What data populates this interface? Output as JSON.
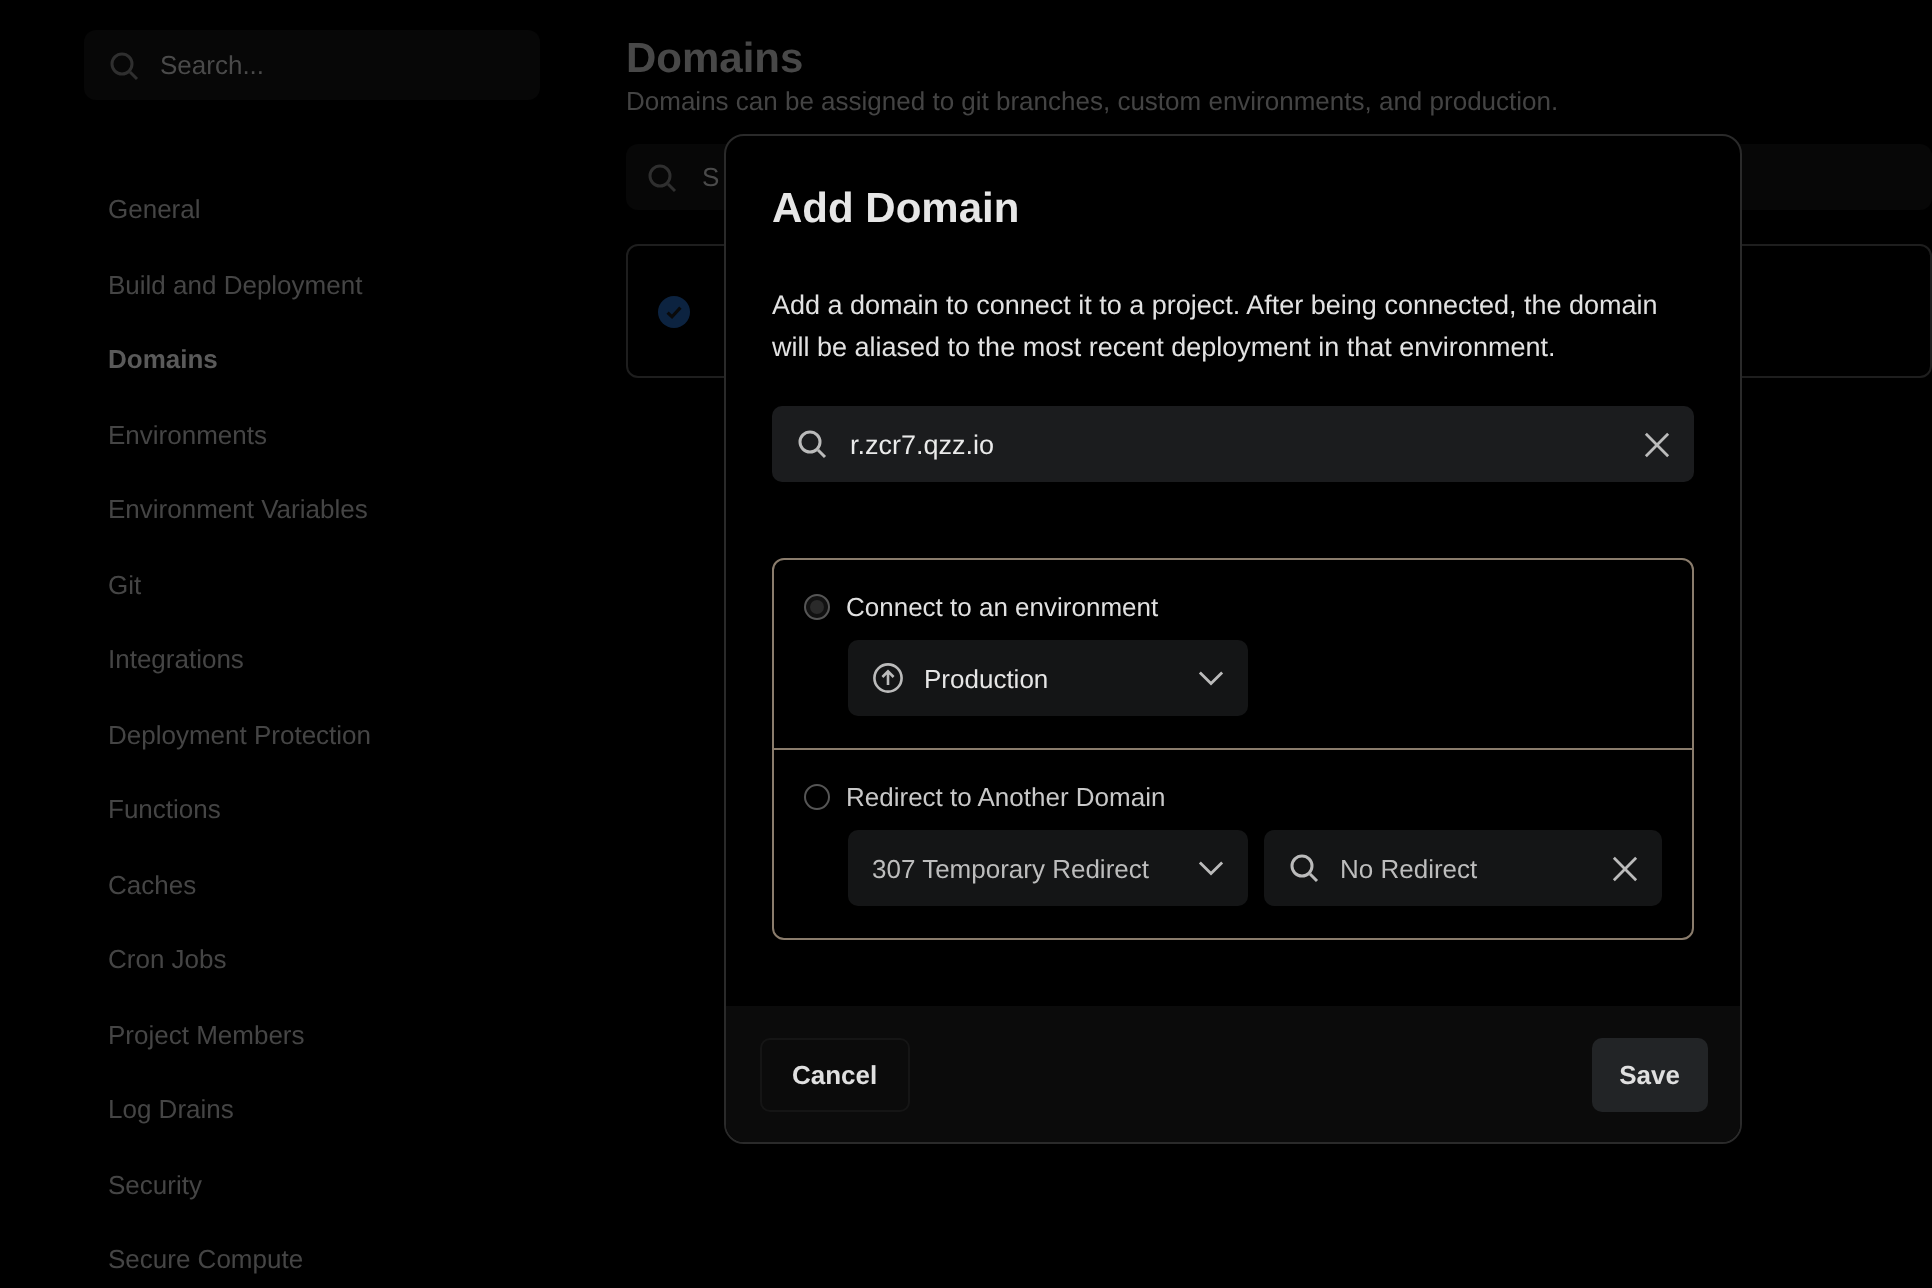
{
  "sidebar": {
    "search": {
      "placeholder": "Search..."
    },
    "items": [
      {
        "label": "General",
        "selected": false
      },
      {
        "label": "Build and Deployment",
        "selected": false
      },
      {
        "label": "Domains",
        "selected": true
      },
      {
        "label": "Environments",
        "selected": false
      },
      {
        "label": "Environment Variables",
        "selected": false
      },
      {
        "label": "Git",
        "selected": false
      },
      {
        "label": "Integrations",
        "selected": false
      },
      {
        "label": "Deployment Protection",
        "selected": false
      },
      {
        "label": "Functions",
        "selected": false
      },
      {
        "label": "Caches",
        "selected": false
      },
      {
        "label": "Cron Jobs",
        "selected": false
      },
      {
        "label": "Project Members",
        "selected": false
      },
      {
        "label": "Log Drains",
        "selected": false
      },
      {
        "label": "Security",
        "selected": false
      },
      {
        "label": "Secure Compute",
        "selected": false
      }
    ]
  },
  "main": {
    "title": "Domains",
    "subtitle": "Domains can be assigned to git branches, custom environments, and production.",
    "search": {
      "placeholder": "S"
    }
  },
  "dialog": {
    "title": "Add Domain",
    "description": "Add a domain to connect it to a project. After being connected, the domain will be aliased to the most recent deployment in that environment.",
    "domain_field": {
      "value": "r.zcr7.qzz.io"
    },
    "options": [
      {
        "label": "Connect to an environment",
        "selected": true,
        "controls": [
          {
            "kind": "environment",
            "value": "Production"
          }
        ]
      },
      {
        "label": "Redirect to Another Domain",
        "selected": false,
        "controls": [
          {
            "kind": "select",
            "value": "307 Temporary Redirect"
          },
          {
            "kind": "search",
            "value": "No Redirect"
          }
        ]
      }
    ],
    "buttons": [
      {
        "label": "Cancel",
        "kind": "secondary"
      },
      {
        "label": "Save",
        "kind": "primary"
      }
    ]
  }
}
